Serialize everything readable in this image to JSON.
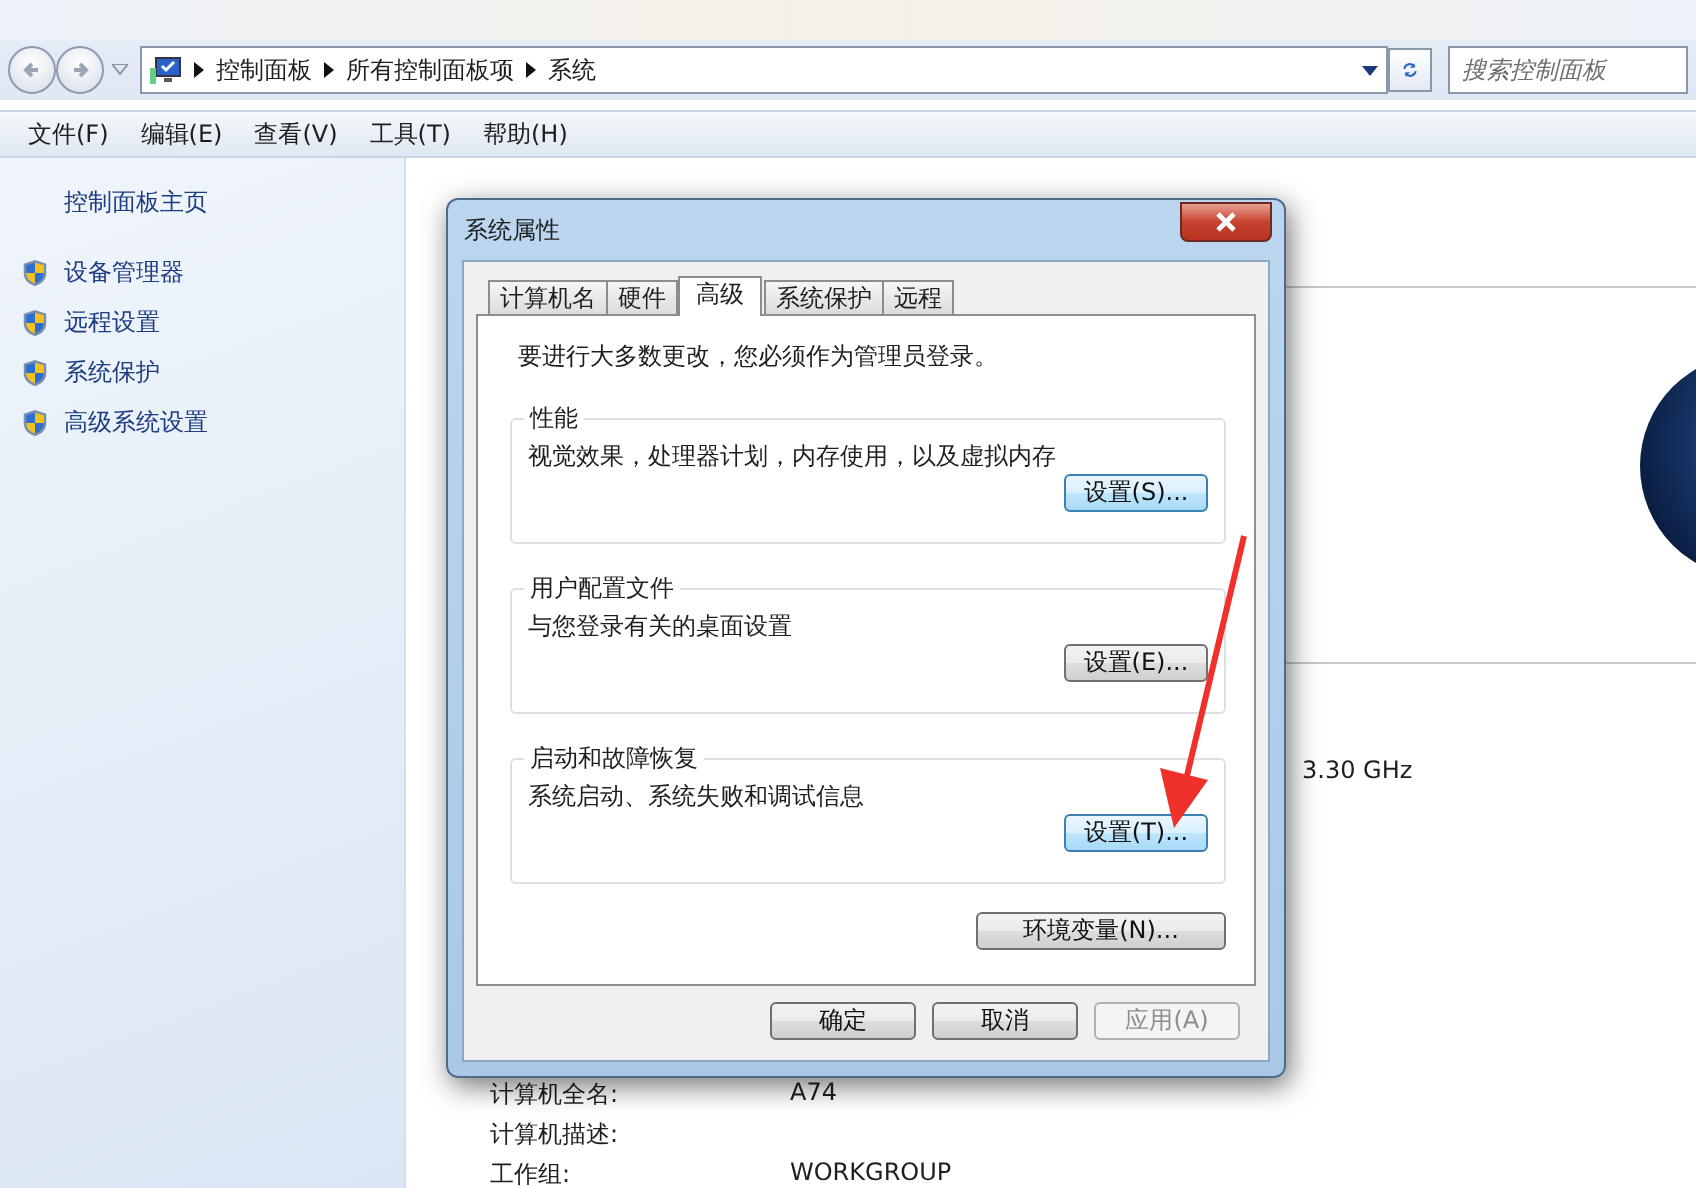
{
  "nav": {
    "breadcrumbs": [
      "控制面板",
      "所有控制面板项",
      "系统"
    ],
    "search": {
      "placeholder": "搜索控制面板"
    }
  },
  "menu": [
    {
      "label": "文件(F)"
    },
    {
      "label": "编辑(E)"
    },
    {
      "label": "查看(V)"
    },
    {
      "label": "工具(T)"
    },
    {
      "label": "帮助(H)"
    }
  ],
  "sidebar": {
    "home": "控制面板主页",
    "items": [
      "设备管理器",
      "远程设置",
      "系统保护",
      "高级系统设置"
    ]
  },
  "main": {
    "processor_speed": "3.30 GHz",
    "info_rows": [
      {
        "label": "计算机全名:",
        "value": "A74"
      },
      {
        "label": "计算机描述:"
      },
      {
        "label": "工作组:",
        "value": "WORKGROUP"
      }
    ]
  },
  "dialog": {
    "title": "系统属性",
    "tabs": [
      {
        "label": "计算机名",
        "selected": false
      },
      {
        "label": "硬件",
        "selected": false
      },
      {
        "label": "高级",
        "selected": true
      },
      {
        "label": "系统保护",
        "selected": false
      },
      {
        "label": "远程",
        "selected": false
      }
    ],
    "notice": "要进行大多数更改，您必须作为管理员登录。",
    "groups": [
      {
        "title": "性能",
        "description": "视觉效果，处理器计划，内存使用，以及虚拟内存",
        "button": "设置(S)...",
        "highlighted": true
      },
      {
        "title": "用户配置文件",
        "description": "与您登录有关的桌面设置",
        "button": "设置(E)...",
        "highlighted": false
      },
      {
        "title": "启动和故障恢复",
        "description": "系统启动、系统失败和调试信息",
        "button": "设置(T)...",
        "highlighted": true
      }
    ],
    "env_button": "环境变量(N)...",
    "buttons": [
      {
        "label": "确定",
        "disabled": false
      },
      {
        "label": "取消",
        "disabled": false
      },
      {
        "label": "应用(A)",
        "disabled": true
      }
    ]
  }
}
